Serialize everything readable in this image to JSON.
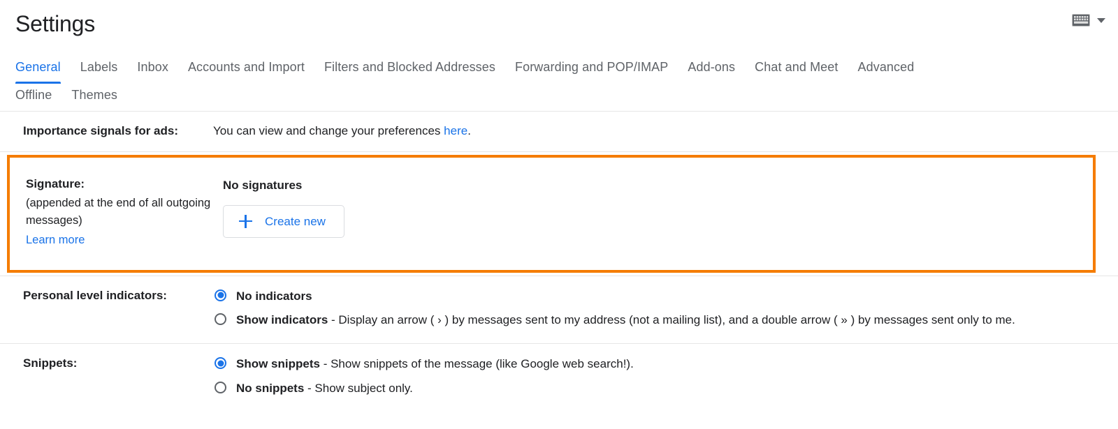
{
  "header": {
    "title": "Settings",
    "keyboard_icon": "keyboard-icon",
    "chevron_icon": "chevron-down-icon"
  },
  "tabs": {
    "row1": [
      {
        "label": "General",
        "active": true
      },
      {
        "label": "Labels",
        "active": false
      },
      {
        "label": "Inbox",
        "active": false
      },
      {
        "label": "Accounts and Import",
        "active": false
      },
      {
        "label": "Filters and Blocked Addresses",
        "active": false
      },
      {
        "label": "Forwarding and POP/IMAP",
        "active": false
      },
      {
        "label": "Add-ons",
        "active": false
      },
      {
        "label": "Chat and Meet",
        "active": false
      },
      {
        "label": "Advanced",
        "active": false
      }
    ],
    "row2": [
      {
        "label": "Offline",
        "active": false
      },
      {
        "label": "Themes",
        "active": false
      }
    ]
  },
  "sections": {
    "importance_signals": {
      "label": "Importance signals for ads:",
      "text_before": "You can view and change your preferences ",
      "link": "here",
      "text_after": "."
    },
    "signature": {
      "label": "Signature:",
      "sub_line1": "(appended at the end of all outgoing",
      "sub_line2": "messages)",
      "learn_more": "Learn more",
      "status": "No signatures",
      "create_button": "Create new",
      "highlight_color": "#f57c00"
    },
    "personal_level_indicators": {
      "label": "Personal level indicators:",
      "options": [
        {
          "bold": "No indicators",
          "rest": "",
          "selected": true
        },
        {
          "bold": "Show indicators",
          "rest": " - Display an arrow ( › ) by messages sent to my address (not a mailing list), and a double arrow ( » ) by messages sent only to me.",
          "selected": false
        }
      ]
    },
    "snippets": {
      "label": "Snippets:",
      "options": [
        {
          "bold": "Show snippets",
          "rest": " - Show snippets of the message (like Google web search!).",
          "selected": true
        },
        {
          "bold": "No snippets",
          "rest": " - Show subject only.",
          "selected": false
        }
      ]
    }
  },
  "colors": {
    "accent_blue": "#1a73e8",
    "highlight_orange": "#f57c00",
    "text_primary": "#202124",
    "text_secondary": "#5f6368",
    "divider": "#e6e6e6"
  }
}
